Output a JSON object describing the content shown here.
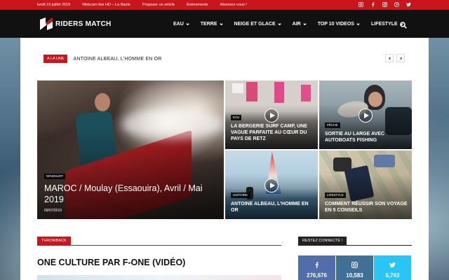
{
  "topbar": {
    "items": [
      "lundi 15 juillet 2019",
      "Webcam live HD – La Baule",
      "Proposer un article",
      "Événements",
      "Abonnez-vous !"
    ],
    "social_icons": [
      "instagram-icon",
      "facebook-icon",
      "instagram-icon",
      "pinterest-icon",
      "twitter-icon"
    ]
  },
  "header": {
    "logo_text": "RIDERS MATCH",
    "nav": [
      "EAU",
      "TERRE",
      "NEIGE ET GLACE",
      "AIR",
      "TOP 10 VIDEOS",
      "LIFESTYLE"
    ]
  },
  "ticker": {
    "label": "A LA UNE",
    "headline": "ANTOINE ALBEAU, L'HOMME EN OR"
  },
  "featured": {
    "category": "WINDSURF",
    "title": "MAROC / Moulay (Essaouira), Avril / Mai 2019",
    "date": "09/07/2019"
  },
  "cards": [
    {
      "category": "EAU",
      "title": "LA BERGERIE SURF CAMP, UNE VAGUE PARFAITE AU CŒUR DU PAYS DE RETZ"
    },
    {
      "category": "PÊCHE",
      "title": "SORTIE AU LARGE AVEC AUTOBOATS FISHING"
    },
    {
      "category": "HISTOIRE",
      "title": "ANTOINE ALBEAU, L'HOMME EN OR"
    },
    {
      "category": "LIFESTYLE",
      "title": "COMMENT RÉUSSIR SON VOYAGE EN 5 CONSEILS"
    }
  ],
  "throwback": {
    "label": "THROWBACK",
    "title": "ONE CULTURE PAR F-ONE (VIDÉO)"
  },
  "connect": {
    "label": "RESTEZ CONNECTÉ !",
    "networks": [
      {
        "icon": "facebook-icon",
        "count": "276,676",
        "color": "#516eab"
      },
      {
        "icon": "instagram-icon",
        "count": "10,583",
        "color": "#417096"
      },
      {
        "icon": "twitter-icon",
        "count": "5,763",
        "color": "#29c5f6"
      }
    ]
  },
  "colors": {
    "accent": "#c9161c",
    "header": "#111111"
  }
}
